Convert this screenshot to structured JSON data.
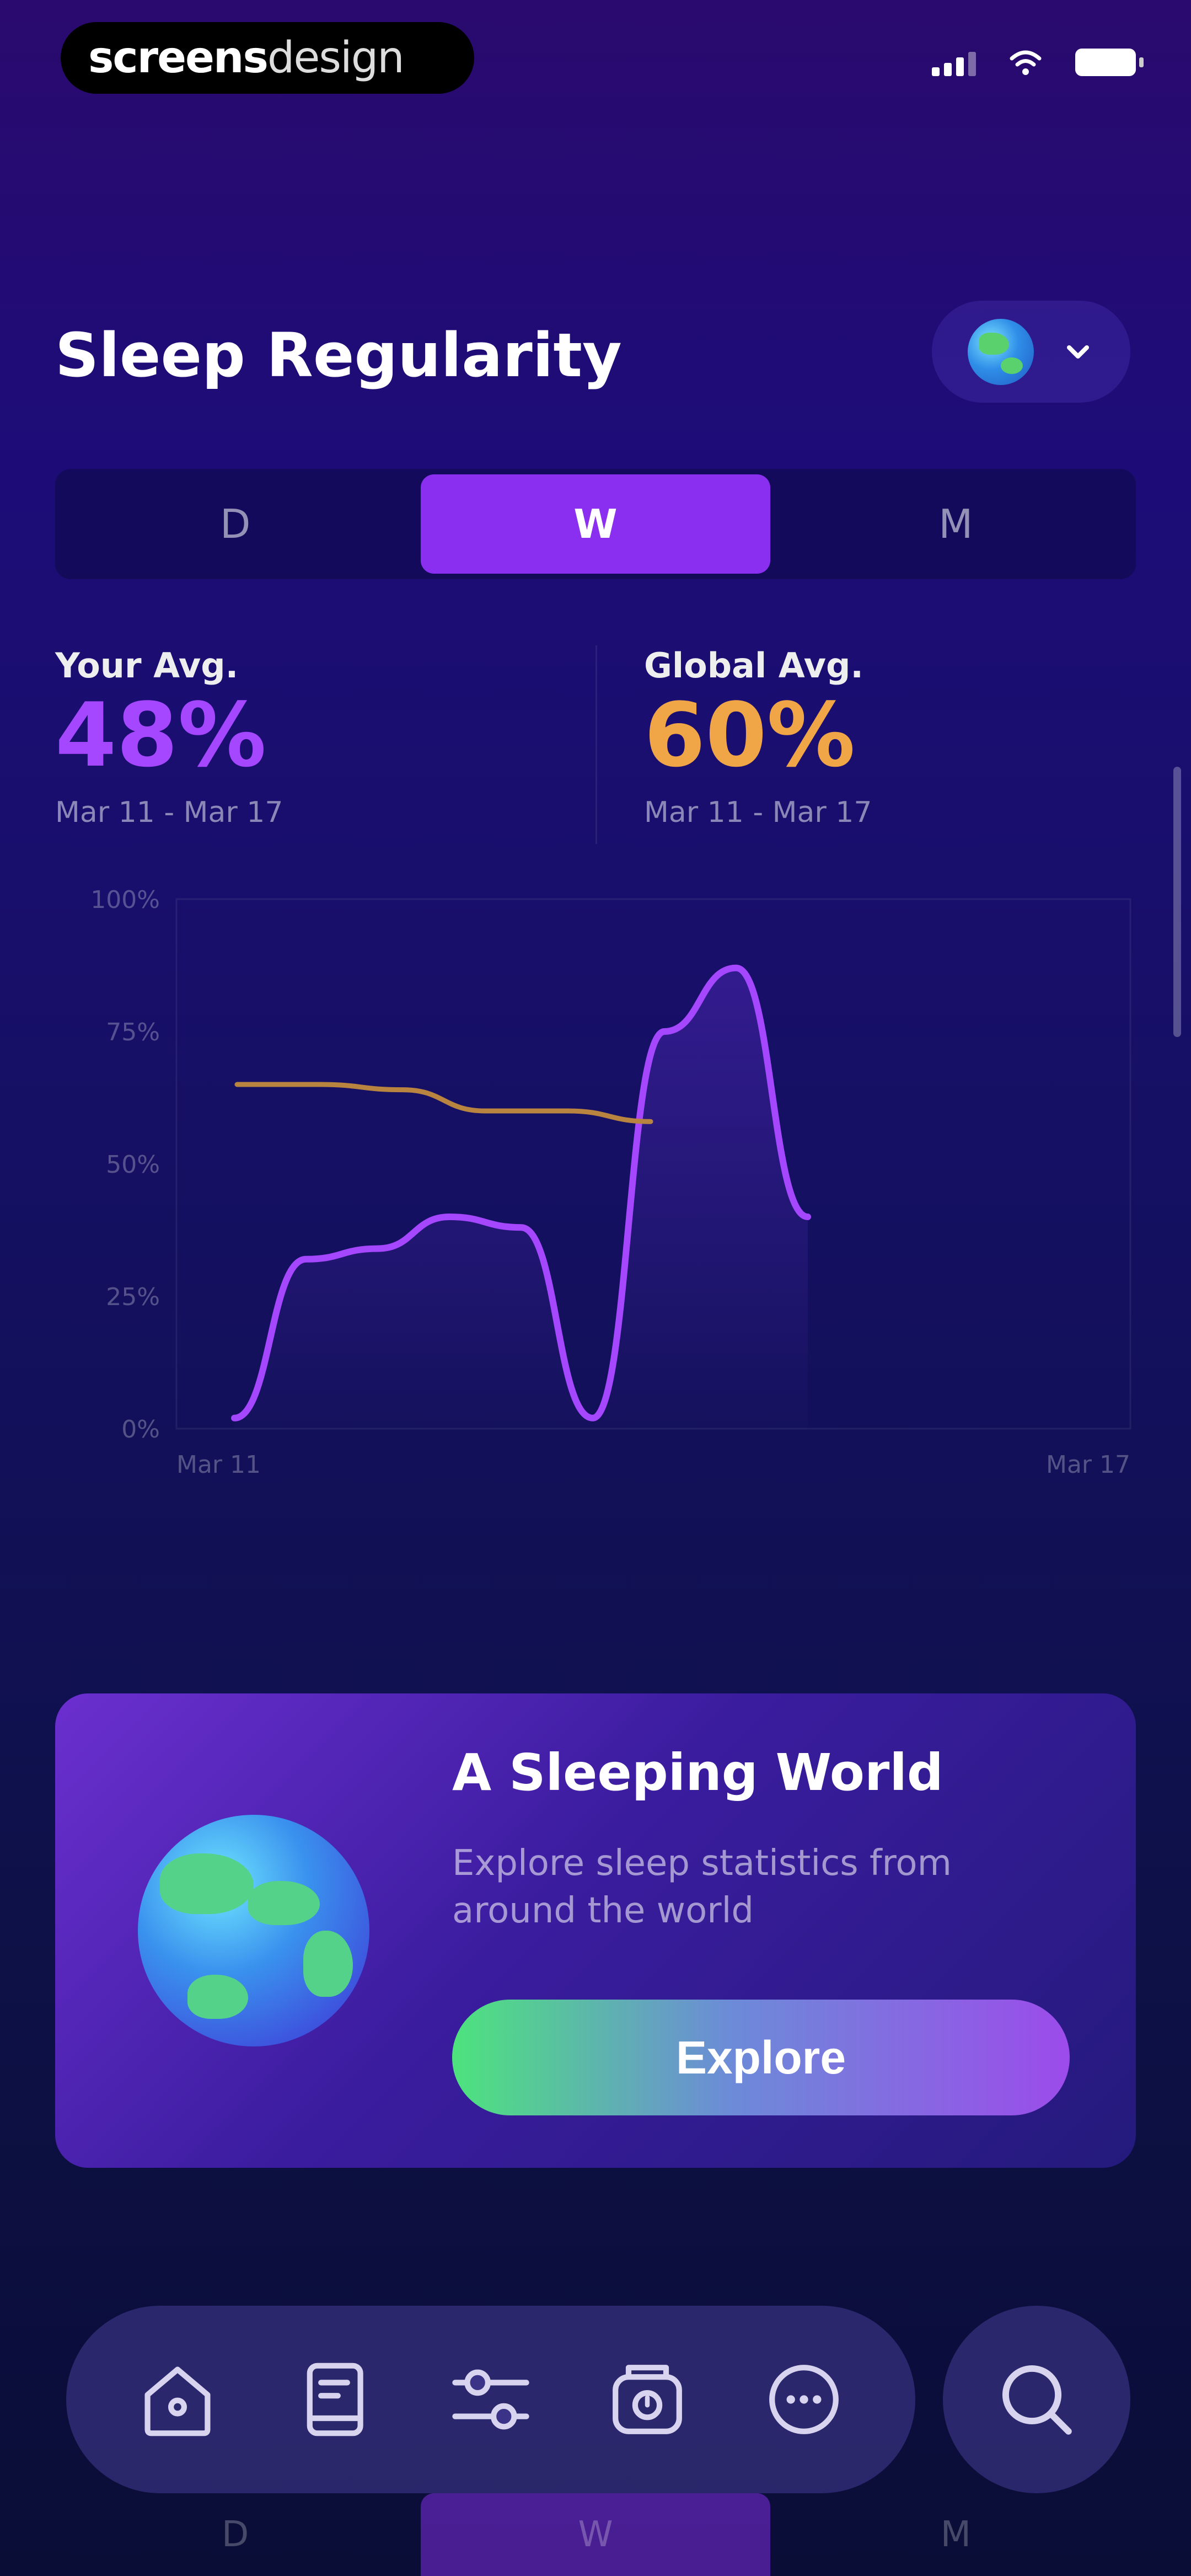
{
  "status_bar": {
    "brand_bold": "screens",
    "brand_light": "design"
  },
  "header": {
    "title": "Sleep Regularity"
  },
  "period_tabs": [
    "D",
    "W",
    "M"
  ],
  "active_tab": "W",
  "stats": {
    "your": {
      "label": "Your Avg.",
      "value": "48%",
      "range": "Mar 11 - Mar 17"
    },
    "global": {
      "label": "Global Avg.",
      "value": "60%",
      "range": "Mar 11 - Mar 17"
    }
  },
  "chart_data": {
    "type": "line",
    "y_tick_labels": [
      "100%",
      "75%",
      "50%",
      "25%",
      "0%"
    ],
    "x_tick_labels": [
      "Mar 11",
      "Mar 17"
    ],
    "ylim": [
      0,
      100
    ],
    "series": [
      {
        "values": [
          2,
          32,
          34,
          40,
          38,
          2,
          75,
          87,
          40
        ],
        "color": "#a447ff"
      },
      {
        "values": [
          65,
          65,
          64,
          60,
          60,
          58
        ],
        "color": "#b9843f"
      }
    ]
  },
  "card": {
    "title": "A Sleeping World",
    "description": "Explore sleep statistics from around the world",
    "button_label": "Explore"
  },
  "bottom_nav": {
    "items": [
      "home-icon",
      "journal-icon",
      "sliders-icon",
      "alarm-clock-icon",
      "more-icon"
    ],
    "search": "search-icon"
  },
  "colors": {
    "accent": "#8a2ff0",
    "your_avg": "#a447ff",
    "global_avg": "#f0a646"
  }
}
